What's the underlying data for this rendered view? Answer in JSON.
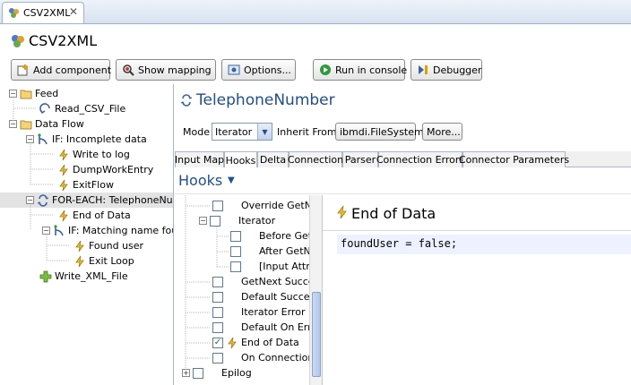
{
  "editor_tab": {
    "label": "CSV2XML",
    "close": "✕"
  },
  "header": {
    "title": "CSV2XML"
  },
  "toolbar": {
    "add_component": "Add component",
    "show_mapping": "Show mapping",
    "options": "Options...",
    "run_in_console": "Run in console",
    "debugger": "Debugger"
  },
  "tree": [
    {
      "label": "Feed"
    },
    {
      "label": "Read_CSV_File"
    },
    {
      "label": "Data Flow"
    },
    {
      "label": "IF: Incomplete data"
    },
    {
      "label": "Write to log"
    },
    {
      "label": "DumpWorkEntry"
    },
    {
      "label": "ExitFlow"
    },
    {
      "label": "FOR-EACH: TelephoneNum"
    },
    {
      "label": "End of Data"
    },
    {
      "label": "IF: Matching name fou"
    },
    {
      "label": "Found user"
    },
    {
      "label": "Exit Loop"
    },
    {
      "label": "Write_XML_File"
    }
  ],
  "component": {
    "title": "TelephoneNumber",
    "mode_label": "Mode",
    "mode_value": "Iterator",
    "inherit_label": "Inherit From",
    "inherit_value": "ibmdi.FileSystem",
    "more": "More..."
  },
  "tabs": [
    "Input Map",
    "Hooks",
    "Delta",
    "Connection",
    "Parser",
    "Connection Errors",
    "Connector Parameters"
  ],
  "hooks_title": "Hooks",
  "hooks": [
    {
      "label": "Override GetN",
      "checked": false
    },
    {
      "label": "Iterator",
      "checked": false
    },
    {
      "label": "Before Get",
      "checked": false
    },
    {
      "label": "After GetN",
      "checked": false
    },
    {
      "label": "[Input Attr",
      "checked": false
    },
    {
      "label": "GetNext Succe",
      "checked": false
    },
    {
      "label": "Default Succes",
      "checked": false
    },
    {
      "label": "Iterator Error",
      "checked": false
    },
    {
      "label": "Default On Err",
      "checked": false
    },
    {
      "label": "End of Data",
      "checked": true
    },
    {
      "label": "On Connection",
      "checked": false
    },
    {
      "label": "Epilog",
      "checked": false
    }
  ],
  "script": {
    "title": "End of Data",
    "code": "foundUser = false;"
  }
}
